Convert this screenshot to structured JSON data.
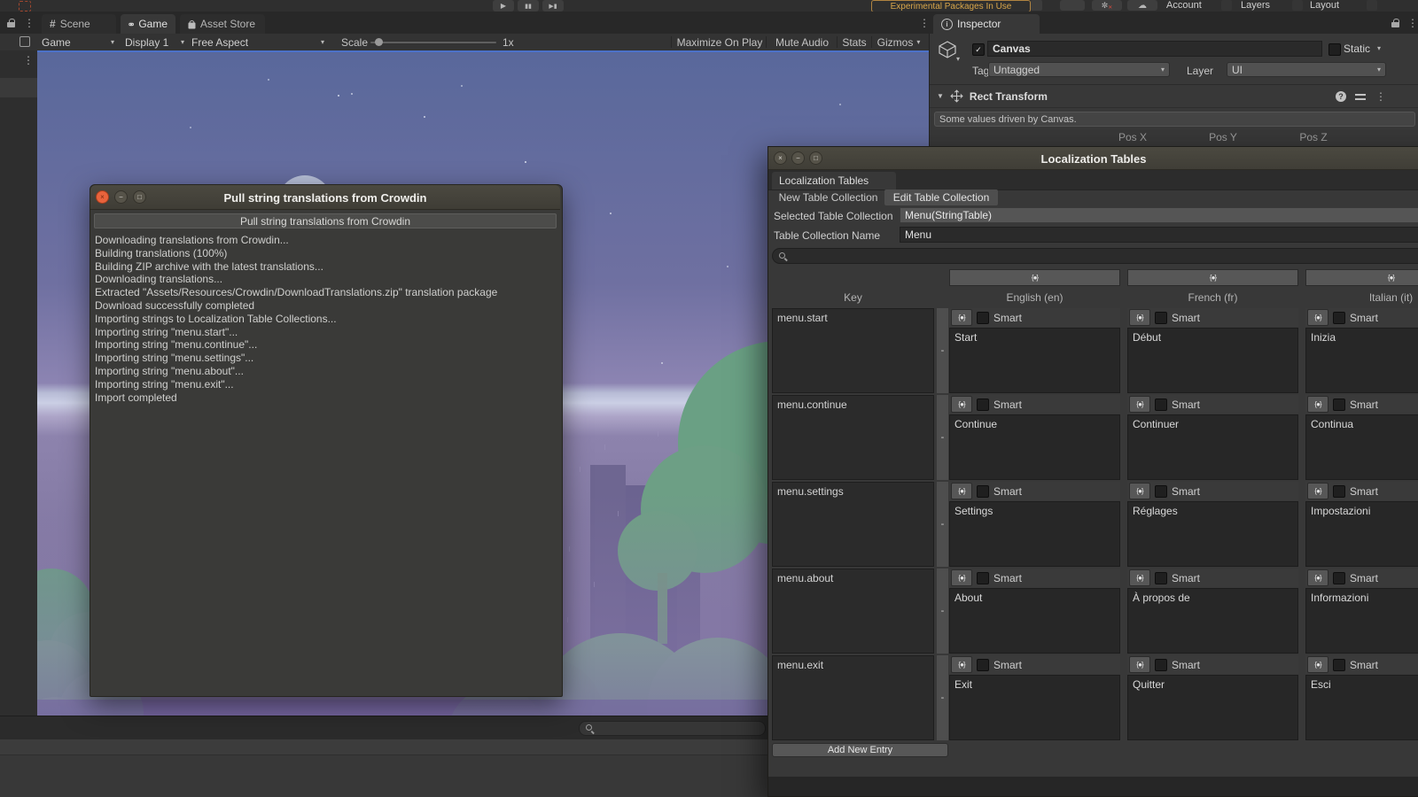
{
  "colors": {
    "experimental_orange": "#d7a54a",
    "ubuntu_titlebar": "#45433c",
    "ubuntu_close_orange": "#e8633c",
    "selection_blue": "#4c71c8",
    "panel_bg": "#383838"
  },
  "icons": {
    "play": "▶",
    "pause": "▮▮",
    "step": "▶▮",
    "dropdown": "▾",
    "foldout": "▼",
    "cloud": "☁",
    "collab": "✼",
    "collab_badge": "✕",
    "menu_dots": "⋮",
    "scene_hash": "#",
    "info": "i",
    "help": "?",
    "check": "✓",
    "minus": "-",
    "metadata": "{●}",
    "close": "×",
    "minimize": "−",
    "maximize": "□"
  },
  "main_toolbar": {
    "experimental_badge": "Experimental Packages In Use",
    "account": "Account",
    "layers": "Layers",
    "layout": "Layout"
  },
  "tabs": {
    "scene": "Scene",
    "game": "Game",
    "asset_store": "Asset Store",
    "inspector": "Inspector"
  },
  "game_toolbar": {
    "game_menu": "Game",
    "display": "Display 1",
    "aspect": "Free Aspect",
    "scale_label": "Scale",
    "scale_value": "1x",
    "maximize_on_play": "Maximize On Play",
    "mute_audio": "Mute Audio",
    "stats": "Stats",
    "gizmos": "Gizmos"
  },
  "inspector": {
    "object_name": "Canvas",
    "static_label": "Static",
    "tag_label": "Tag",
    "tag_value": "Untagged",
    "layer_label": "Layer",
    "layer_value": "UI",
    "component_name": "Rect Transform",
    "help_text": "Some values driven by Canvas.",
    "pos_x": "Pos X",
    "pos_y": "Pos Y",
    "pos_z": "Pos Z"
  },
  "crowdin_dialog": {
    "title": "Pull string translations from Crowdin",
    "action_button": "Pull string translations from Crowdin",
    "log": [
      "Downloading translations from Crowdin...",
      "Building translations (100%)",
      "Building ZIP archive with the latest translations...",
      "Downloading translations...",
      "Extracted \"Assets/Resources/Crowdin/DownloadTranslations.zip\" translation package",
      "Download successfully completed",
      "Importing strings to Localization Table Collections...",
      "Importing string \"menu.start\"...",
      "Importing string \"menu.continue\"...",
      "Importing string \"menu.settings\"...",
      "Importing string \"menu.about\"...",
      "Importing string \"menu.exit\"...",
      "Import completed"
    ]
  },
  "localization": {
    "window_title": "Localization Tables",
    "tab_label": "Localization Tables",
    "new_collection": "New Table Collection",
    "edit_collection": "Edit Table Collection",
    "selected_label": "Selected Table Collection",
    "selected_value": "Menu(StringTable)",
    "name_label": "Table Collection Name",
    "name_value": "Menu",
    "key_header": "Key",
    "smart_label": "Smart",
    "add_entry": "Add New Entry",
    "columns": [
      "English (en)",
      "French (fr)",
      "Italian (it)"
    ],
    "rows": [
      {
        "key": "menu.start",
        "values": [
          "Start",
          "Début",
          "Inizia"
        ]
      },
      {
        "key": "menu.continue",
        "values": [
          "Continue",
          "Continuer",
          "Continua"
        ]
      },
      {
        "key": "menu.settings",
        "values": [
          "Settings",
          "Réglages",
          "Impostazioni"
        ]
      },
      {
        "key": "menu.about",
        "values": [
          "About",
          "À propos de",
          "Informazioni"
        ]
      },
      {
        "key": "menu.exit",
        "values": [
          "Exit",
          "Quitter",
          "Esci"
        ]
      }
    ]
  }
}
